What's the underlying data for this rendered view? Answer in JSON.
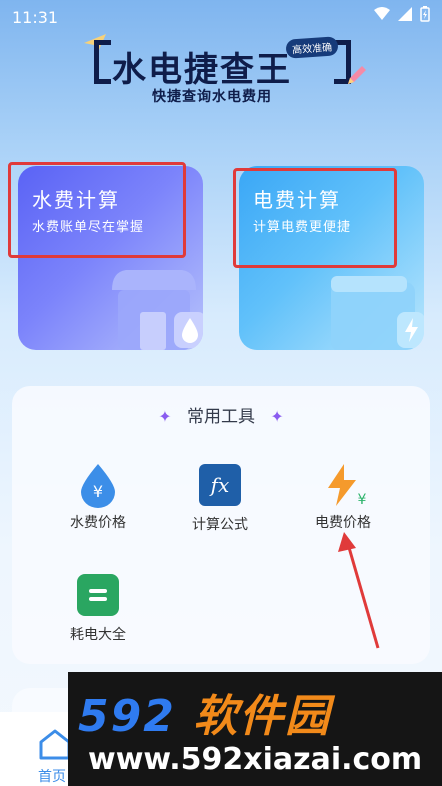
{
  "status": {
    "time": "11:31"
  },
  "header": {
    "title": "水电捷查王",
    "badge": "高效准确",
    "subtitle": "快捷查询水电费用"
  },
  "cards": {
    "water": {
      "title": "水费计算",
      "subtitle": "水费账单尽在掌握"
    },
    "electric": {
      "title": "电费计算",
      "subtitle": "计算电费更便捷"
    }
  },
  "tools": {
    "title": "常用工具",
    "items": [
      {
        "label": "水费价格",
        "icon": "water-price-icon"
      },
      {
        "label": "计算公式",
        "icon": "formula-icon",
        "glyph": "fx"
      },
      {
        "label": "电费价格",
        "icon": "electric-price-icon"
      },
      {
        "label": "耗电大全",
        "icon": "power-consumption-icon"
      }
    ]
  },
  "nav": {
    "home_label": "首页"
  },
  "watermark": {
    "brand_num": "592",
    "brand_text": "软件园",
    "url": "www.592xiazai.com"
  },
  "colors": {
    "highlight": "#e03a3a",
    "accent": "#3c8de8",
    "watermark_blue": "#2f7bf0",
    "watermark_orange": "#f28a1a"
  }
}
